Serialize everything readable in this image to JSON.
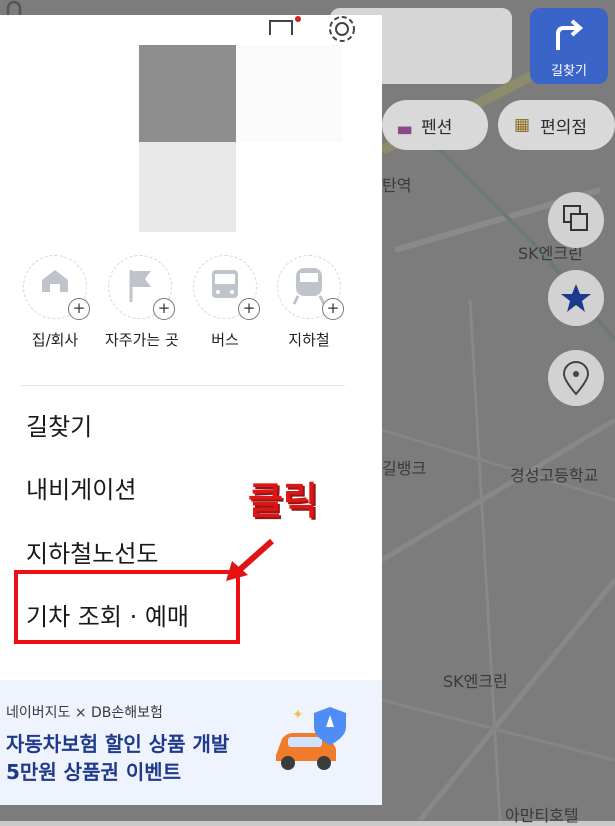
{
  "map": {
    "labels": [
      "탄역",
      "SK엔크린",
      "길뱅크",
      "경성고등학교",
      "SK엔크린",
      "아만티호텔"
    ],
    "route_button_label": "길찾기",
    "chips": [
      "펜션",
      "편의점"
    ]
  },
  "quick_access": [
    {
      "label": "집/회사"
    },
    {
      "label": "자주가는 곳"
    },
    {
      "label": "버스"
    },
    {
      "label": "지하철"
    }
  ],
  "menu": {
    "items": [
      "길찾기",
      "내비게이션",
      "지하철노선도",
      "기차 조회 · 예매"
    ]
  },
  "annotation": {
    "click_label": "클릭"
  },
  "ad": {
    "brand": "네이버지도 × DB손해보험",
    "line1": "자동차보험 할인 상품 개발",
    "line2": "5만원 상품권 이벤트"
  },
  "colors": {
    "highlight": "#ee1010",
    "ad_text": "#1f3a8a",
    "route_button": "#3b64c9"
  }
}
